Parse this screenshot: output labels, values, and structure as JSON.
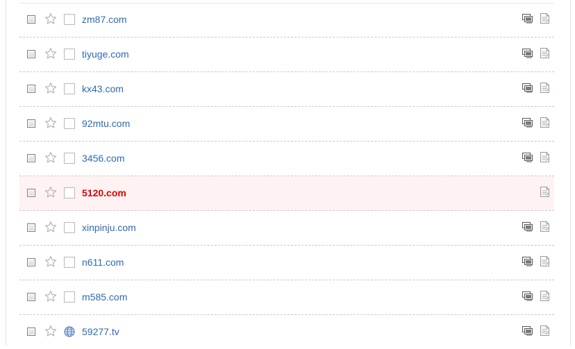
{
  "rows": [
    {
      "name": "zm87.com",
      "favicon": "blank-icon",
      "snapshot": true,
      "highlight": false
    },
    {
      "name": "tiyuge.com",
      "favicon": "blank-icon",
      "snapshot": true,
      "highlight": false
    },
    {
      "name": "kx43.com",
      "favicon": "blank-icon",
      "snapshot": true,
      "highlight": false
    },
    {
      "name": "92mtu.com",
      "favicon": "blank-icon",
      "snapshot": true,
      "highlight": false
    },
    {
      "name": "3456.com",
      "favicon": "blank-icon",
      "snapshot": true,
      "highlight": false
    },
    {
      "name": "5120.com",
      "favicon": "blank-icon",
      "snapshot": false,
      "highlight": true
    },
    {
      "name": "xinpinju.com",
      "favicon": "blank-icon",
      "snapshot": true,
      "highlight": false
    },
    {
      "name": "n611.com",
      "favicon": "blank-icon",
      "snapshot": true,
      "highlight": false
    },
    {
      "name": "m585.com",
      "favicon": "blank-icon",
      "snapshot": true,
      "highlight": false
    },
    {
      "name": "59277.tv",
      "favicon": "globe-icon",
      "snapshot": true,
      "highlight": false
    }
  ],
  "colors": {
    "link": "#2e6ab1",
    "highlight_text": "#e00000",
    "highlight_bg": "#fff2f2"
  }
}
